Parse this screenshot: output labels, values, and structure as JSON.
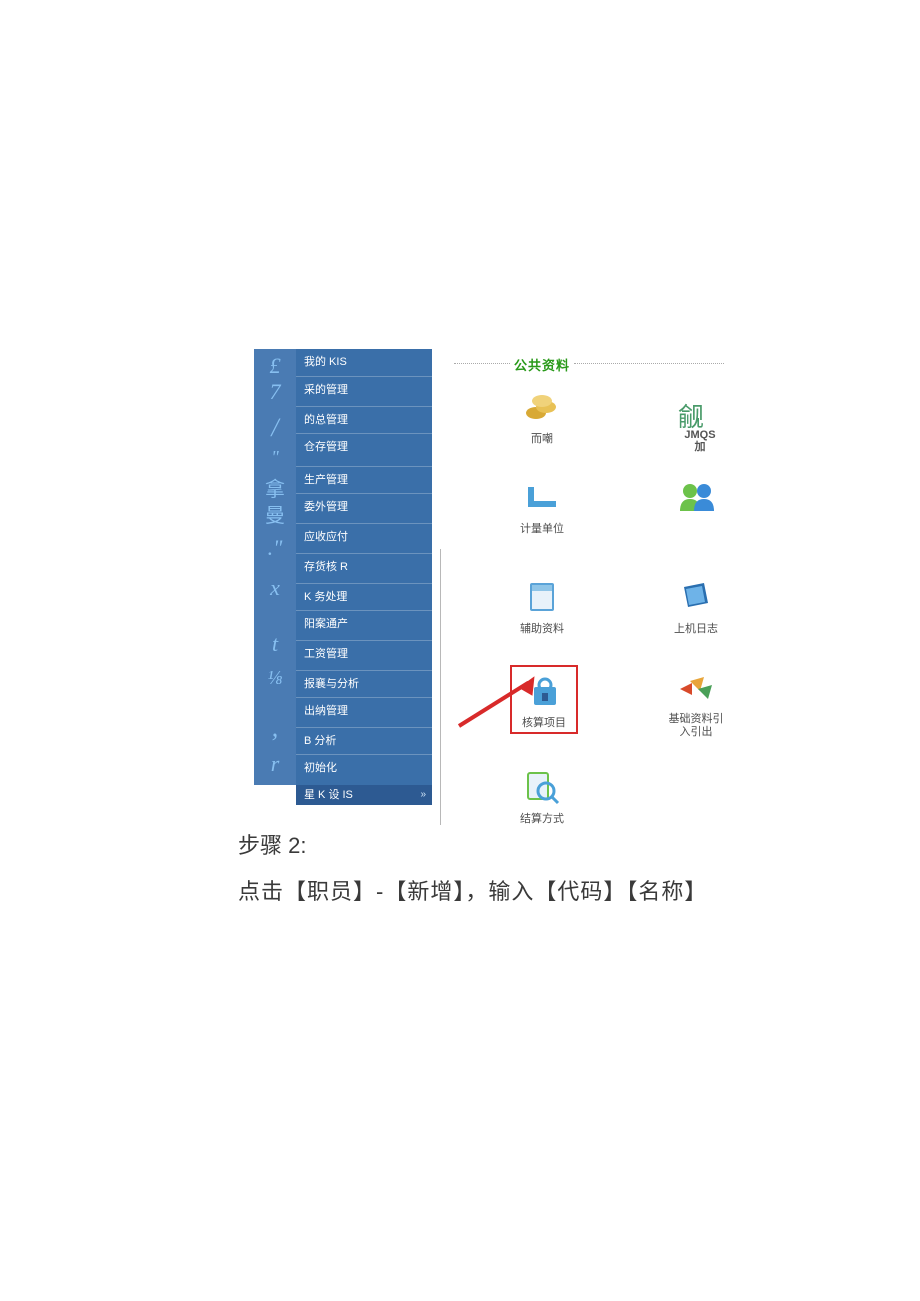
{
  "sidebar": {
    "icons": [
      "£",
      "7",
      "/",
      "\"",
      "拿",
      "曼",
      ".\"",
      "x",
      "t",
      "⅛",
      ",",
      "r"
    ],
    "items": [
      "我的 KIS",
      "采的管理",
      "的总管理",
      "仓存管理",
      "生产管理",
      "委外管理",
      "应收应付",
      "存货核 R",
      "K 务处理",
      "阳案通产",
      "工资管理",
      "报襄与分析",
      "出纳管理",
      "B 分析",
      "初始化"
    ],
    "footer": "星 K 设 IS",
    "footer_chevron": "»"
  },
  "main": {
    "heading": "公共资料",
    "tiles": {
      "currency": {
        "label": "而嘲"
      },
      "unit": {
        "label": "计量单位"
      },
      "aux": {
        "label": "辅助资料"
      },
      "log": {
        "label": "上机日志"
      },
      "acct": {
        "label": "核算项目"
      },
      "import": {
        "label": "基础资料引\n入引出"
      },
      "settle": {
        "label": "结算方式"
      }
    },
    "rt_top": {
      "big": "觎",
      "line1": "JMQS",
      "line2": "加"
    }
  },
  "document": {
    "step_title": "步骤 2:",
    "step_body": "点击【职员】-【新增】，输入【代码】【名称】"
  }
}
